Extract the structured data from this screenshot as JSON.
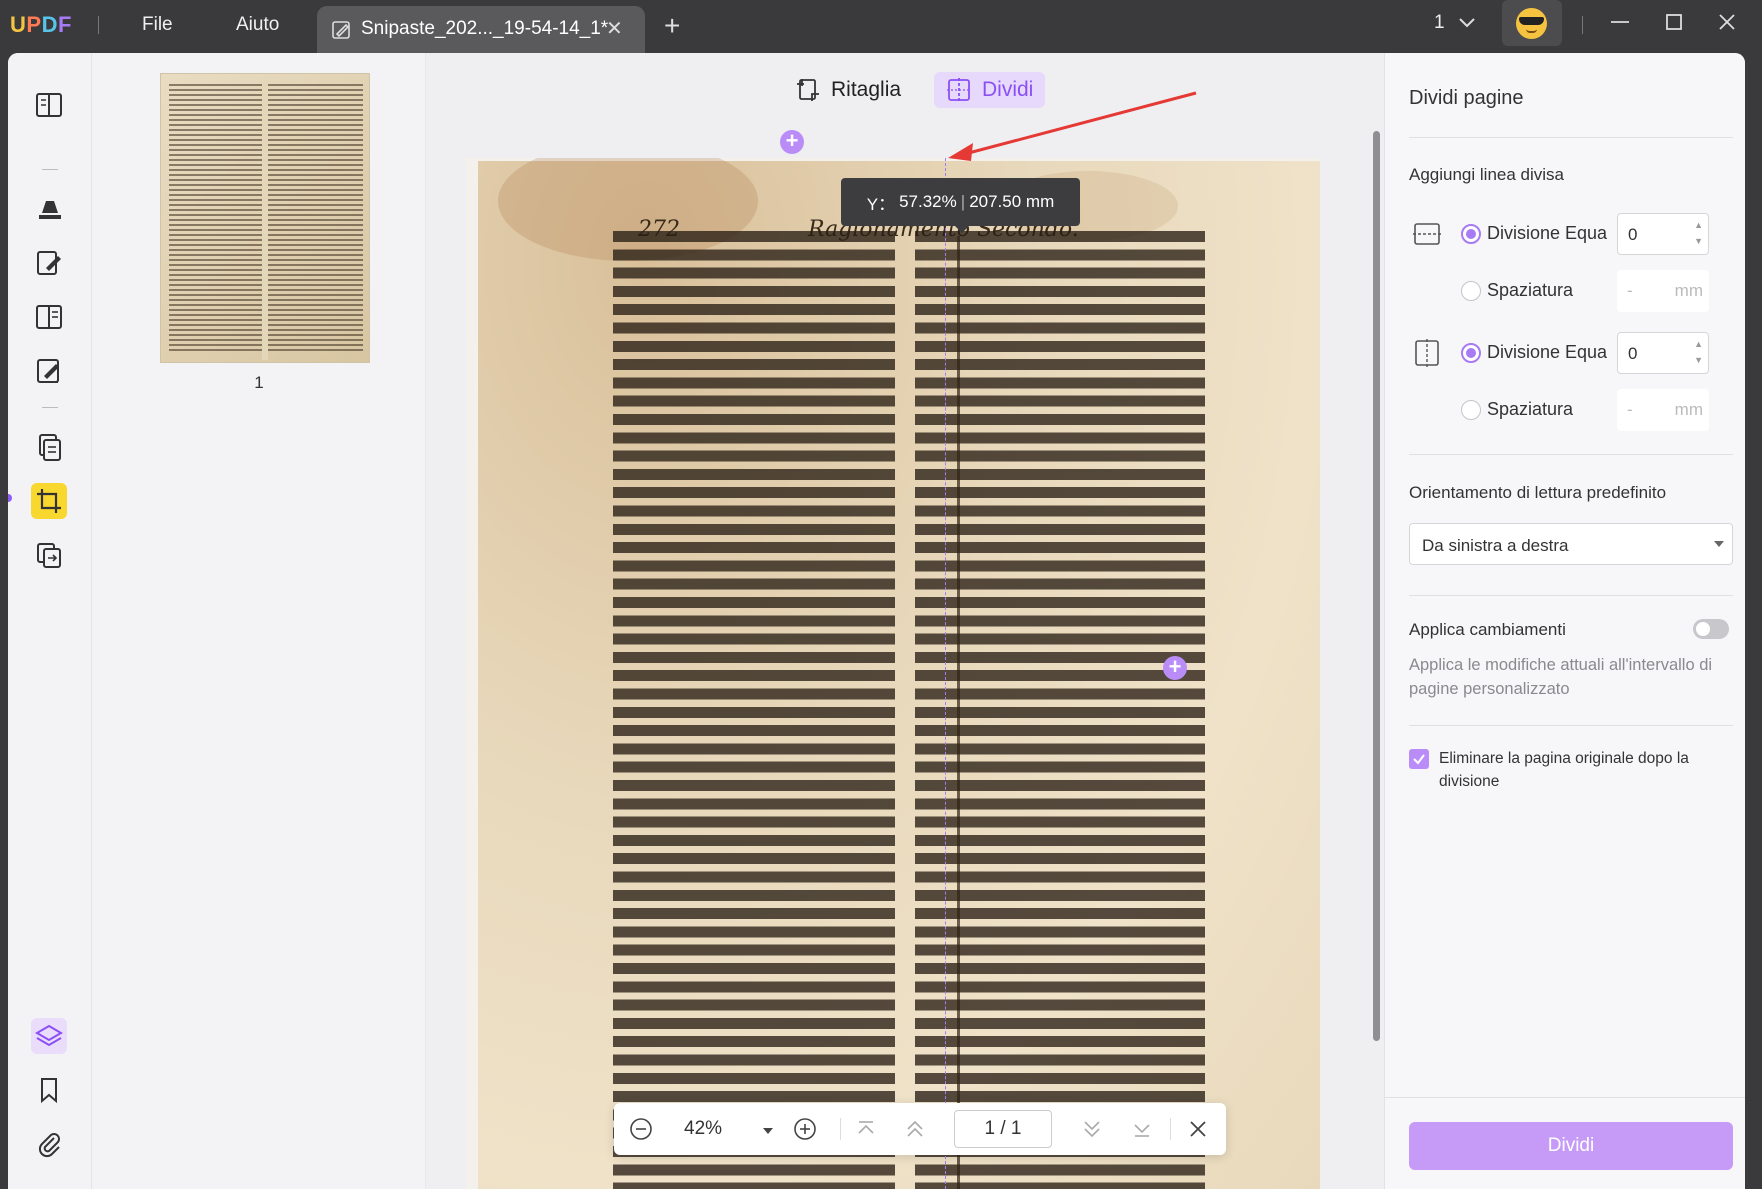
{
  "app": {
    "logo": "UPDF",
    "menu": [
      "File",
      "Aiuto"
    ],
    "tab_title": "Snipaste_202..._19-54-14_1*",
    "page_selector": "1"
  },
  "thumbnails": {
    "page_label": "1"
  },
  "toolbar": {
    "crop_label": "Ritaglia",
    "split_label": "Dividi"
  },
  "split_tooltip": {
    "axis": "Y：",
    "percent": "57.32%",
    "sep": "|",
    "mm": "207.50 mm"
  },
  "document_page": {
    "header_page_number": "272",
    "header_title": "Ragionamento Secondo."
  },
  "zoombar": {
    "zoom": "42%",
    "page_indicator": "1 / 1"
  },
  "right_panel": {
    "title": "Dividi pagine",
    "add_line_label": "Aggiungi linea divisa",
    "horizontal": {
      "equal_label": "Divisione Equa",
      "equal_value": "0",
      "spacing_label": "Spaziatura",
      "spacing_value": "-",
      "spacing_unit": "mm"
    },
    "vertical": {
      "equal_label": "Divisione Equa",
      "equal_value": "0",
      "spacing_label": "Spaziatura",
      "spacing_value": "-",
      "spacing_unit": "mm"
    },
    "reading_orientation_label": "Orientamento di lettura predefinito",
    "reading_orientation_value": "Da sinistra a destra",
    "apply_changes_label": "Applica cambiamenti",
    "apply_changes_desc": "Applica le modifiche attuali all'intervallo di pagine personalizzato",
    "delete_original_label": "Eliminare la pagina originale dopo la divisione",
    "split_button": "Dividi"
  },
  "colors": {
    "accent": "#a77bf3",
    "accent_light": "#e6d9fc",
    "active_tool": "#f8d72f",
    "annotation_arrow": "#e53935"
  }
}
